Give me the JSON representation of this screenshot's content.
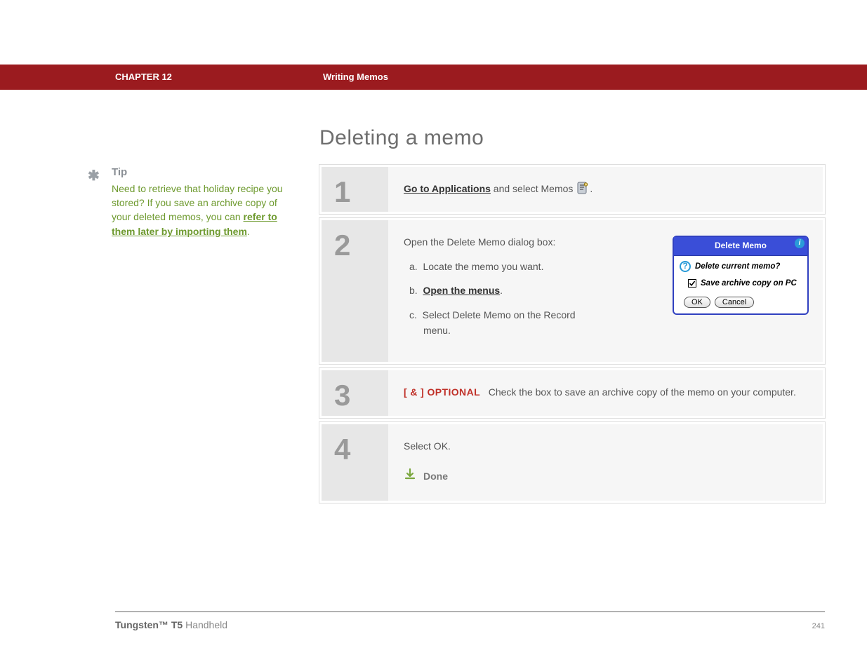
{
  "header": {
    "chapter": "CHAPTER 12",
    "section_title": "Writing Memos"
  },
  "page": {
    "heading": "Deleting a memo"
  },
  "tip": {
    "label": "Tip",
    "body_plain": "Need to retrieve that holiday recipe you stored? If you save an archive copy of your deleted memos, you can ",
    "link_text": "refer to them later by importing them",
    "trailing": "."
  },
  "steps": [
    {
      "num": "1",
      "line1_link": "Go to Applications",
      "line1_rest": " and select Memos ",
      "trailing": "."
    },
    {
      "num": "2",
      "intro": "Open the Delete Memo dialog box:",
      "items": [
        {
          "prefix": "a.",
          "text": "Locate the memo you want."
        },
        {
          "prefix": "b.",
          "link": "Open the menus",
          "suffix": "."
        },
        {
          "prefix": "c.",
          "text": "Select Delete Memo on the Record menu."
        }
      ]
    },
    {
      "num": "3",
      "optional_tag": "[ & ]  OPTIONAL",
      "text": "Check the box to save an archive copy of the memo on your computer."
    },
    {
      "num": "4",
      "text": "Select OK.",
      "done_label": "Done"
    }
  ],
  "dialog": {
    "title": "Delete Memo",
    "question": "Delete current memo?",
    "checkbox_label": "Save archive copy on PC",
    "checkbox_checked": true,
    "ok": "OK",
    "cancel": "Cancel"
  },
  "footer": {
    "product_bold": "Tungsten™ T5",
    "product_rest": " Handheld",
    "page_number": "241"
  }
}
